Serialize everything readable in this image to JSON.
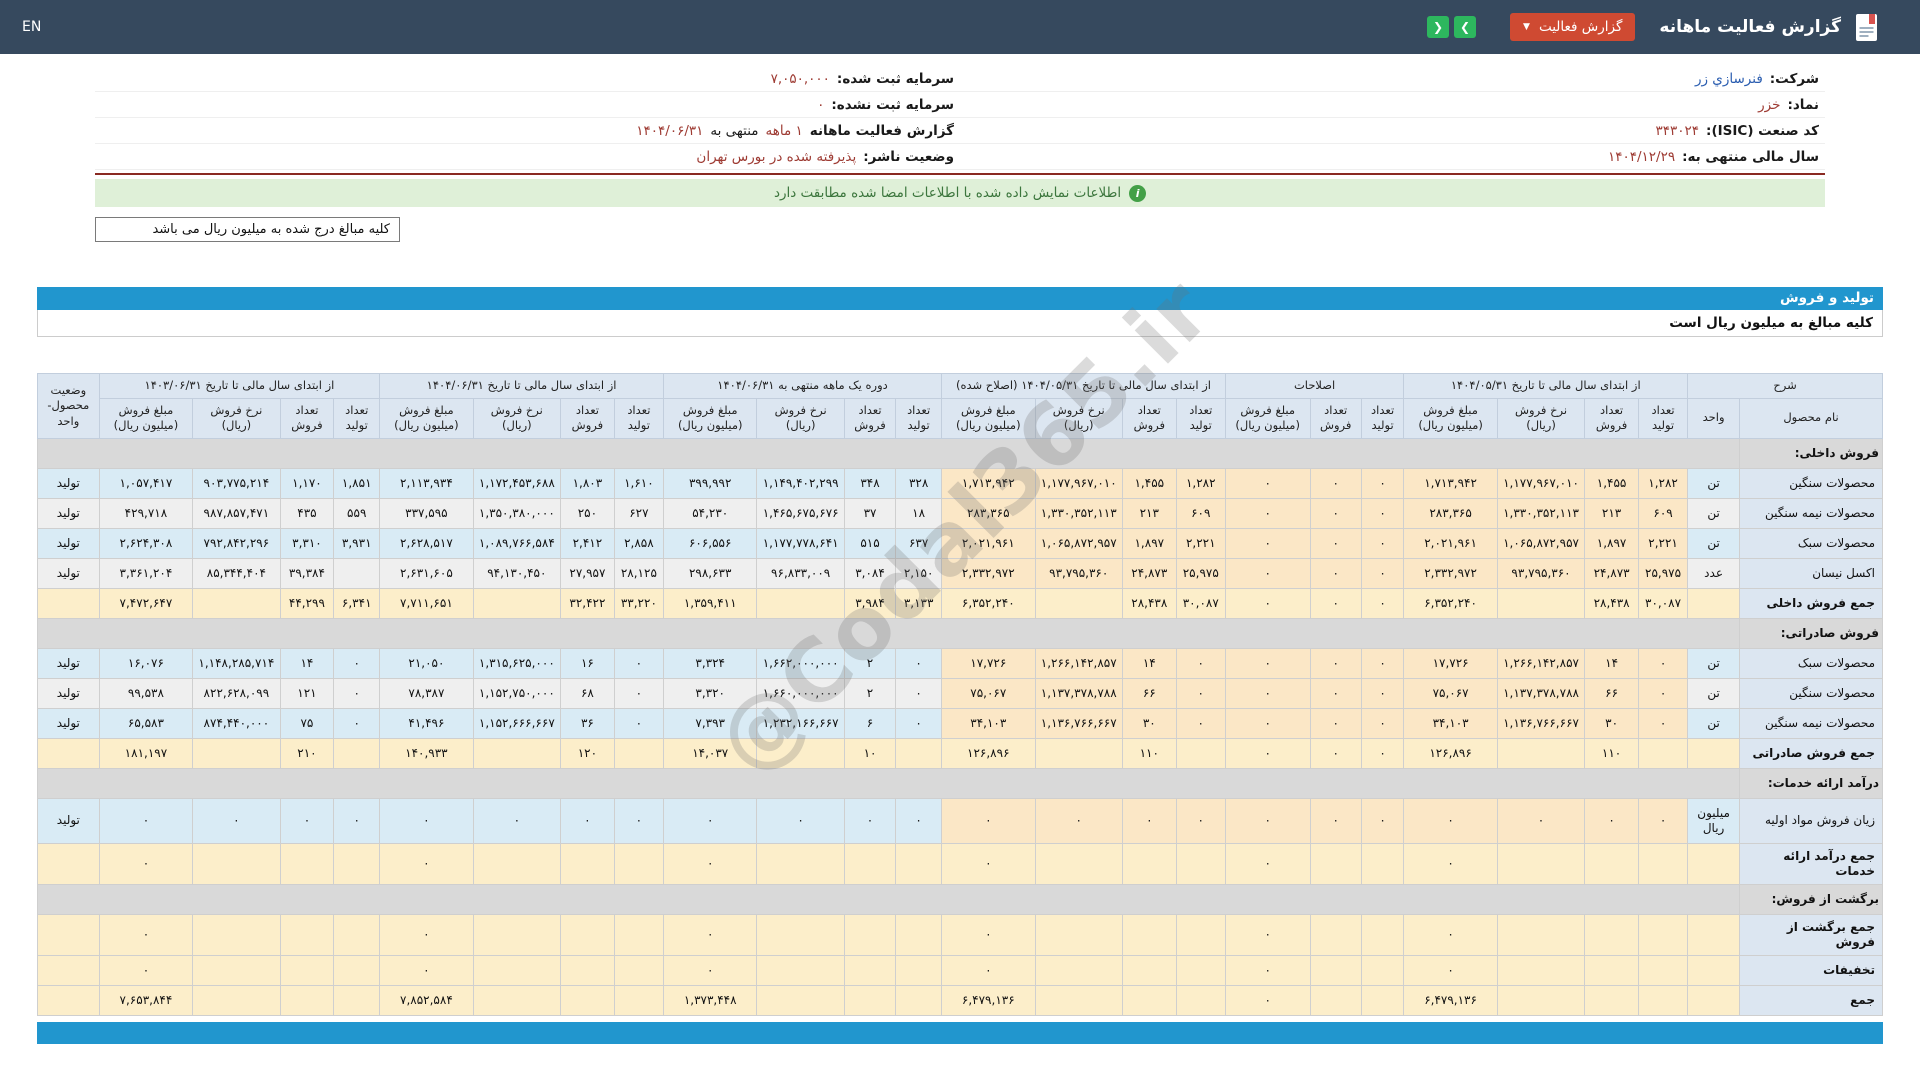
{
  "topbar": {
    "en_label": "EN",
    "title": "گزارش فعالیت ماهانه",
    "report_button": "گزارش فعالیت",
    "report_button_caret": "▼",
    "prev_icon": "❯",
    "next_icon": "❮"
  },
  "info": {
    "company_label": "شرکت:",
    "company": "فنرسازي زر",
    "symbol_label": "نماد:",
    "symbol": "خزر",
    "isic_label": "کد صنعت (ISIC):",
    "isic": "۳۴۳۰۲۴",
    "fiscal_year_label": "سال مالی منتهی به:",
    "fiscal_year": "۱۴۰۴/۱۲/۲۹",
    "registered_capital_label": "سرمایه ثبت شده:",
    "registered_capital": "۷,۰۵۰,۰۰۰",
    "unregistered_capital_label": "سرمایه ثبت نشده:",
    "unregistered_capital": "۰",
    "report_period_label": "گزارش فعالیت ماهانه",
    "report_period": "۱ ماهه",
    "report_period_mid": "منتهی به",
    "report_period_date": "۱۴۰۴/۰۶/۳۱",
    "issuer_status_label": "وضعیت ناشر:",
    "issuer_status": "پذیرفته شده در بورس تهران"
  },
  "notice": {
    "icon": "i",
    "text": "اطلاعات نمایش داده شده با اطلاعات امضا شده مطابقت دارد"
  },
  "amounts_note": "کلیه مبالغ درج شده به میلیون ریال می باشد",
  "section_title": "تولید و فروش",
  "section_subtitle": "کلیه مبالغ به میلیون ریال است",
  "watermark": "@Codal365.ir",
  "table": {
    "sharh_header": "شرح",
    "name_header": "نام محصول",
    "unit_header": "واحد",
    "status_header": "وضعیت محصول-واحد",
    "sub": {
      "prod": "تعداد تولید",
      "sold": "تعداد فروش",
      "rate": "نرخ فروش (ریال)",
      "amount": "مبلغ فروش (میلیون ریال)"
    },
    "groups": [
      {
        "label": "از ابتدای سال مالی تا تاریخ ۱۴۰۴/۰۵/۳۱",
        "cols": 4
      },
      {
        "label": "اصلاحات",
        "cols": 3
      },
      {
        "label": "از ابتدای سال مالی تا تاریخ ۱۴۰۴/۰۵/۳۱ (اصلاح شده)",
        "cols": 4
      },
      {
        "label": "دوره یک ماهه منتهی به ۱۴۰۴/۰۶/۳۱",
        "cols": 4
      },
      {
        "label": "از ابتدای سال مالی تا تاریخ ۱۴۰۴/۰۶/۳۱",
        "cols": 4
      },
      {
        "label": "از ابتدای سال مالی تا تاریخ ۱۴۰۳/۰۶/۳۱",
        "cols": 4
      }
    ],
    "rows": [
      {
        "type": "section",
        "name": "فروش داخلی:"
      },
      {
        "type": "data",
        "shade": "blue",
        "name": "محصولات سنگین",
        "unit": "تن",
        "status": "تولید",
        "cells": [
          "۱,۲۸۲",
          "۱,۴۵۵",
          "۱,۱۷۷,۹۶۷,۰۱۰",
          "۱,۷۱۳,۹۴۲",
          "۰",
          "۰",
          "۰",
          "۱,۲۸۲",
          "۱,۴۵۵",
          "۱,۱۷۷,۹۶۷,۰۱۰",
          "۱,۷۱۳,۹۴۲",
          "۳۲۸",
          "۳۴۸",
          "۱,۱۴۹,۴۰۲,۲۹۹",
          "۳۹۹,۹۹۲",
          "۱,۶۱۰",
          "۱,۸۰۳",
          "۱,۱۷۲,۴۵۳,۶۸۸",
          "۲,۱۱۳,۹۳۴",
          "۱,۸۵۱",
          "۱,۱۷۰",
          "۹۰۳,۷۷۵,۲۱۴",
          "۱,۰۵۷,۴۱۷"
        ]
      },
      {
        "type": "data",
        "shade": "gray",
        "name": "محصولات نیمه سنگین",
        "unit": "تن",
        "status": "تولید",
        "cells": [
          "۶۰۹",
          "۲۱۳",
          "۱,۳۳۰,۳۵۲,۱۱۳",
          "۲۸۳,۳۶۵",
          "۰",
          "۰",
          "۰",
          "۶۰۹",
          "۲۱۳",
          "۱,۳۳۰,۳۵۲,۱۱۳",
          "۲۸۳,۳۶۵",
          "۱۸",
          "۳۷",
          "۱,۴۶۵,۶۷۵,۶۷۶",
          "۵۴,۲۳۰",
          "۶۲۷",
          "۲۵۰",
          "۱,۳۵۰,۳۸۰,۰۰۰",
          "۳۳۷,۵۹۵",
          "۵۵۹",
          "۴۳۵",
          "۹۸۷,۸۵۷,۴۷۱",
          "۴۲۹,۷۱۸"
        ]
      },
      {
        "type": "data",
        "shade": "blue",
        "name": "محصولات سبک",
        "unit": "تن",
        "status": "تولید",
        "cells": [
          "۲,۲۲۱",
          "۱,۸۹۷",
          "۱,۰۶۵,۸۷۲,۹۵۷",
          "۲,۰۲۱,۹۶۱",
          "۰",
          "۰",
          "۰",
          "۲,۲۲۱",
          "۱,۸۹۷",
          "۱,۰۶۵,۸۷۲,۹۵۷",
          "۲,۰۲۱,۹۶۱",
          "۶۳۷",
          "۵۱۵",
          "۱,۱۷۷,۷۷۸,۶۴۱",
          "۶۰۶,۵۵۶",
          "۲,۸۵۸",
          "۲,۴۱۲",
          "۱,۰۸۹,۷۶۶,۵۸۴",
          "۲,۶۲۸,۵۱۷",
          "۳,۹۳۱",
          "۳,۳۱۰",
          "۷۹۲,۸۴۲,۲۹۶",
          "۲,۶۲۴,۳۰۸"
        ]
      },
      {
        "type": "data",
        "shade": "gray",
        "name": "اکسل نیسان",
        "unit": "عدد",
        "status": "تولید",
        "cells": [
          "۲۵,۹۷۵",
          "۲۴,۸۷۳",
          "۹۳,۷۹۵,۳۶۰",
          "۲,۳۳۲,۹۷۲",
          "۰",
          "۰",
          "۰",
          "۲۵,۹۷۵",
          "۲۴,۸۷۳",
          "۹۳,۷۹۵,۳۶۰",
          "۲,۳۳۲,۹۷۲",
          "۲,۱۵۰",
          "۳,۰۸۴",
          "۹۶,۸۳۳,۰۰۹",
          "۲۹۸,۶۳۳",
          "۲۸,۱۲۵",
          "۲۷,۹۵۷",
          "۹۴,۱۳۰,۴۵۰",
          "۲,۶۳۱,۶۰۵",
          "",
          "۳۹,۳۸۴",
          "۸۵,۳۴۴,۴۰۴",
          "۳,۳۶۱,۲۰۴"
        ]
      },
      {
        "type": "total",
        "name": "جمع فروش داخلی",
        "cells": [
          "۳۰,۰۸۷",
          "۲۸,۴۳۸",
          "",
          "۶,۳۵۲,۲۴۰",
          "۰",
          "۰",
          "۰",
          "۳۰,۰۸۷",
          "۲۸,۴۳۸",
          "",
          "۶,۳۵۲,۲۴۰",
          "۳,۱۳۳",
          "۳,۹۸۴",
          "",
          "۱,۳۵۹,۴۱۱",
          "۳۳,۲۲۰",
          "۳۲,۴۲۲",
          "",
          "۷,۷۱۱,۶۵۱",
          "۶,۳۴۱",
          "۴۴,۲۹۹",
          "",
          "۷,۴۷۲,۶۴۷"
        ]
      },
      {
        "type": "section",
        "name": "فروش صادراتی:"
      },
      {
        "type": "data",
        "shade": "blue",
        "name": "محصولات سبک",
        "unit": "تن",
        "status": "تولید",
        "cells": [
          "۰",
          "۱۴",
          "۱,۲۶۶,۱۴۲,۸۵۷",
          "۱۷,۷۲۶",
          "۰",
          "۰",
          "۰",
          "۰",
          "۱۴",
          "۱,۲۶۶,۱۴۲,۸۵۷",
          "۱۷,۷۲۶",
          "۰",
          "۲",
          "۱,۶۶۲,۰۰۰,۰۰۰",
          "۳,۳۲۴",
          "۰",
          "۱۶",
          "۱,۳۱۵,۶۲۵,۰۰۰",
          "۲۱,۰۵۰",
          "۰",
          "۱۴",
          "۱,۱۴۸,۲۸۵,۷۱۴",
          "۱۶,۰۷۶"
        ]
      },
      {
        "type": "data",
        "shade": "gray",
        "name": "محصولات سنگین",
        "unit": "تن",
        "status": "تولید",
        "cells": [
          "۰",
          "۶۶",
          "۱,۱۳۷,۳۷۸,۷۸۸",
          "۷۵,۰۶۷",
          "۰",
          "۰",
          "۰",
          "۰",
          "۶۶",
          "۱,۱۳۷,۳۷۸,۷۸۸",
          "۷۵,۰۶۷",
          "۰",
          "۲",
          "۱,۶۶۰,۰۰۰,۰۰۰",
          "۳,۳۲۰",
          "۰",
          "۶۸",
          "۱,۱۵۲,۷۵۰,۰۰۰",
          "۷۸,۳۸۷",
          "۰",
          "۱۲۱",
          "۸۲۲,۶۲۸,۰۹۹",
          "۹۹,۵۳۸"
        ]
      },
      {
        "type": "data",
        "shade": "blue",
        "name": "محصولات نیمه سنگین",
        "unit": "تن",
        "status": "تولید",
        "cells": [
          "۰",
          "۳۰",
          "۱,۱۳۶,۷۶۶,۶۶۷",
          "۳۴,۱۰۳",
          "۰",
          "۰",
          "۰",
          "۰",
          "۳۰",
          "۱,۱۳۶,۷۶۶,۶۶۷",
          "۳۴,۱۰۳",
          "۰",
          "۶",
          "۱,۲۳۲,۱۶۶,۶۶۷",
          "۷,۳۹۳",
          "۰",
          "۳۶",
          "۱,۱۵۲,۶۶۶,۶۶۷",
          "۴۱,۴۹۶",
          "۰",
          "۷۵",
          "۸۷۴,۴۴۰,۰۰۰",
          "۶۵,۵۸۳"
        ]
      },
      {
        "type": "total",
        "name": "جمع فروش صادراتی",
        "cells": [
          "",
          "۱۱۰",
          "",
          "۱۲۶,۸۹۶",
          "۰",
          "۰",
          "۰",
          "",
          "۱۱۰",
          "",
          "۱۲۶,۸۹۶",
          "",
          "۱۰",
          "",
          "۱۴,۰۳۷",
          "",
          "۱۲۰",
          "",
          "۱۴۰,۹۳۳",
          "",
          "۲۱۰",
          "",
          "۱۸۱,۱۹۷"
        ]
      },
      {
        "type": "section",
        "name": "درآمد ارائه خدمات:"
      },
      {
        "type": "data",
        "shade": "blue",
        "name": "زیان فروش مواد اولیه",
        "unit": "میلیون ریال",
        "status": "تولید",
        "cells": [
          "۰",
          "۰",
          "۰",
          "۰",
          "۰",
          "۰",
          "۰",
          "۰",
          "۰",
          "۰",
          "۰",
          "۰",
          "۰",
          "۰",
          "۰",
          "۰",
          "۰",
          "۰",
          "۰",
          "۰",
          "۰",
          "۰",
          "۰"
        ]
      },
      {
        "type": "total",
        "name": "جمع درآمد ارائه خدمات",
        "cells": [
          "",
          "",
          "",
          "۰",
          "",
          "",
          "۰",
          "",
          "",
          "",
          "۰",
          "",
          "",
          "",
          "۰",
          "",
          "",
          "",
          "۰",
          "",
          "",
          "",
          "۰"
        ]
      },
      {
        "type": "section",
        "name": "برگشت از فروش:"
      },
      {
        "type": "total",
        "name": "جمع برگشت از فروش",
        "cells": [
          "",
          "",
          "",
          "۰",
          "",
          "",
          "۰",
          "",
          "",
          "",
          "۰",
          "",
          "",
          "",
          "۰",
          "",
          "",
          "",
          "۰",
          "",
          "",
          "",
          "۰"
        ]
      },
      {
        "type": "total",
        "name": "تخفیفات",
        "cells": [
          "",
          "",
          "",
          "۰",
          "",
          "",
          "۰",
          "",
          "",
          "",
          "۰",
          "",
          "",
          "",
          "۰",
          "",
          "",
          "",
          "۰",
          "",
          "",
          "",
          "۰"
        ]
      },
      {
        "type": "total",
        "name": "جمع",
        "cells": [
          "",
          "",
          "",
          "۶,۴۷۹,۱۳۶",
          "",
          "",
          "۰",
          "",
          "",
          "",
          "۶,۴۷۹,۱۳۶",
          "",
          "",
          "",
          "۱,۳۷۳,۴۴۸",
          "",
          "",
          "",
          "۷,۸۵۲,۵۸۴",
          "",
          "",
          "",
          "۷,۶۵۳,۸۴۴"
        ]
      }
    ]
  }
}
